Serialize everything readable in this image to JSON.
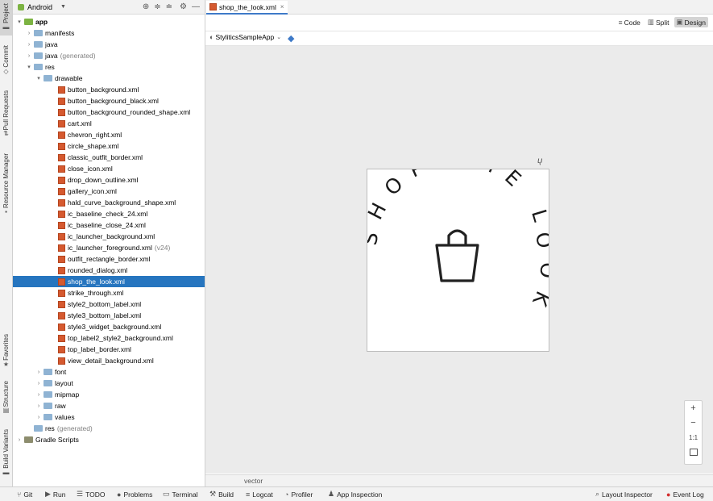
{
  "left_strip": {
    "project": "Project",
    "commit": "Commit",
    "pull_requests": "Pull Requests",
    "resource_manager": "Resource Manager",
    "favorites": "Favorites",
    "structure": "Structure",
    "build_variants": "Build Variants"
  },
  "project_panel": {
    "view_selector": "Android",
    "tree": [
      {
        "label": "app",
        "suffix": ""
      },
      {
        "label": "manifests",
        "suffix": ""
      },
      {
        "label": "java",
        "suffix": ""
      },
      {
        "label": "java",
        "suffix": "(generated)"
      },
      {
        "label": "res",
        "suffix": ""
      },
      {
        "label": "drawable",
        "suffix": ""
      },
      {
        "label": "button_background.xml",
        "suffix": ""
      },
      {
        "label": "button_background_black.xml",
        "suffix": ""
      },
      {
        "label": "button_background_rounded_shape.xml",
        "suffix": ""
      },
      {
        "label": "cart.xml",
        "suffix": ""
      },
      {
        "label": "chevron_right.xml",
        "suffix": ""
      },
      {
        "label": "circle_shape.xml",
        "suffix": ""
      },
      {
        "label": "classic_outfit_border.xml",
        "suffix": ""
      },
      {
        "label": "close_icon.xml",
        "suffix": ""
      },
      {
        "label": "drop_down_outline.xml",
        "suffix": ""
      },
      {
        "label": "gallery_icon.xml",
        "suffix": ""
      },
      {
        "label": "hald_curve_background_shape.xml",
        "suffix": ""
      },
      {
        "label": "ic_baseline_check_24.xml",
        "suffix": ""
      },
      {
        "label": "ic_baseline_close_24.xml",
        "suffix": ""
      },
      {
        "label": "ic_launcher_background.xml",
        "suffix": ""
      },
      {
        "label": "ic_launcher_foreground.xml",
        "suffix": "(v24)"
      },
      {
        "label": "outfit_rectangle_border.xml",
        "suffix": ""
      },
      {
        "label": "rounded_dialog.xml",
        "suffix": ""
      },
      {
        "label": "shop_the_look.xml",
        "suffix": ""
      },
      {
        "label": "strike_through.xml",
        "suffix": ""
      },
      {
        "label": "style2_bottom_label.xml",
        "suffix": ""
      },
      {
        "label": "style3_bottom_label.xml",
        "suffix": ""
      },
      {
        "label": "style3_widget_background.xml",
        "suffix": ""
      },
      {
        "label": "top_label2_style2_background.xml",
        "suffix": ""
      },
      {
        "label": "top_label_border.xml",
        "suffix": ""
      },
      {
        "label": "view_detail_background.xml",
        "suffix": ""
      },
      {
        "label": "font",
        "suffix": ""
      },
      {
        "label": "layout",
        "suffix": ""
      },
      {
        "label": "mipmap",
        "suffix": ""
      },
      {
        "label": "raw",
        "suffix": ""
      },
      {
        "label": "values",
        "suffix": ""
      },
      {
        "label": "res",
        "suffix": "(generated)"
      },
      {
        "label": "Gradle Scripts",
        "suffix": ""
      }
    ]
  },
  "editor": {
    "tab_label": "shop_the_look.xml",
    "view_modes": {
      "code": "Code",
      "split": "Split",
      "design": "Design",
      "active": "Design"
    },
    "theme_selector": "StyliticsSampleApp",
    "preview_text": "SHOP THE LOOK",
    "zoom_controls": {
      "plus": "+",
      "minus": "−",
      "actual": "1:1"
    },
    "footer_label": "vector"
  },
  "status_bar": {
    "git": "Git",
    "run": "Run",
    "todo": "TODO",
    "problems": "Problems",
    "terminal": "Terminal",
    "build": "Build",
    "logcat": "Logcat",
    "profiler": "Profiler",
    "app_inspection": "App Inspection",
    "layout_inspector": "Layout Inspector",
    "event_log": "Event Log"
  },
  "colors": {
    "selection": "#2675bf",
    "accent_tab": "#3e7ac8",
    "xml_icon": "#d5592f",
    "folder": "#8fb3d3"
  }
}
